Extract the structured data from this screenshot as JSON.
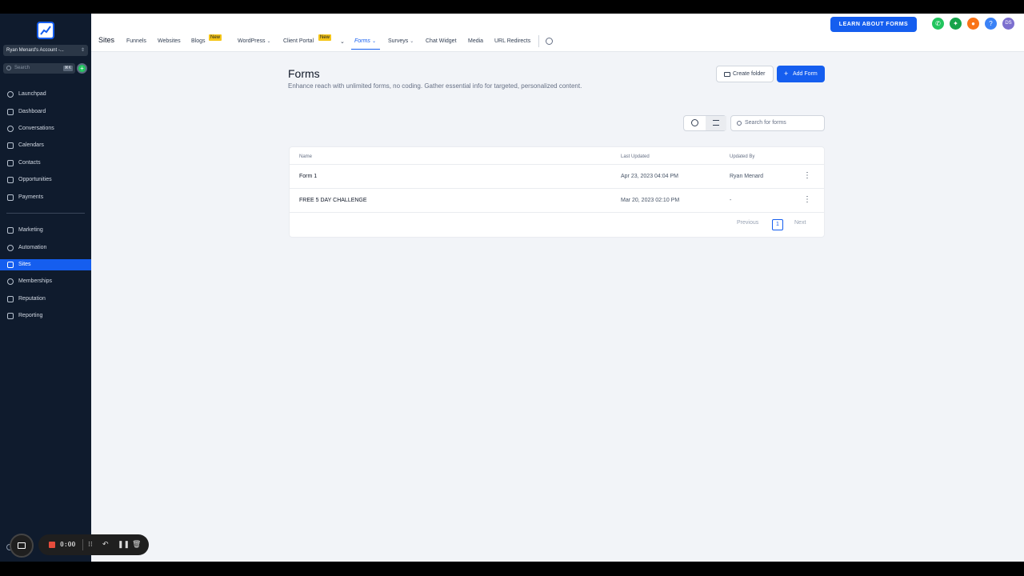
{
  "sidebar": {
    "account": "Ryan Menard's Account -...",
    "search_placeholder": "Search",
    "search_shortcut": "⌘K",
    "items": [
      {
        "label": "Launchpad",
        "icon": "rocket-icon"
      },
      {
        "label": "Dashboard",
        "icon": "dashboard-icon"
      },
      {
        "label": "Conversations",
        "icon": "chat-icon"
      },
      {
        "label": "Calendars",
        "icon": "calendar-icon"
      },
      {
        "label": "Contacts",
        "icon": "contacts-icon"
      },
      {
        "label": "Opportunities",
        "icon": "filter-icon"
      },
      {
        "label": "Payments",
        "icon": "payments-icon"
      },
      {
        "label": "Marketing",
        "icon": "send-icon"
      },
      {
        "label": "Automation",
        "icon": "automation-icon"
      },
      {
        "label": "Sites",
        "icon": "sites-icon"
      },
      {
        "label": "Memberships",
        "icon": "memberships-icon"
      },
      {
        "label": "Reputation",
        "icon": "star-icon"
      },
      {
        "label": "Reporting",
        "icon": "trend-icon"
      }
    ],
    "active_item": "Sites"
  },
  "topbar": {
    "title": "Sites",
    "tabs": [
      "Funnels",
      "Websites",
      "Blogs",
      "WordPress",
      "Client Portal",
      "Forms",
      "Surveys",
      "Chat Widget",
      "Media",
      "URL Redirects"
    ],
    "active_tab": "Forms",
    "new_badge": "New",
    "learn_button": "LEARN ABOUT FORMS",
    "avatar_initials": "DS",
    "help_glyph": "?"
  },
  "main": {
    "title": "Forms",
    "description": "Enhance reach with unlimited forms, no coding. Gather essential info for targeted, personalized content.",
    "create_folder": "Create folder",
    "add_form": "Add Form",
    "search_placeholder": "Search for forms",
    "table": {
      "headers": [
        "Name",
        "Last Updated",
        "Updated By"
      ],
      "rows": [
        {
          "name": "Form 1",
          "updated": "Apr 23, 2023 04:04 PM",
          "by": "Ryan Menard"
        },
        {
          "name": "FREE 5 DAY CHALLENGE",
          "updated": "Mar 20, 2023 02:10 PM",
          "by": "-"
        }
      ],
      "previous": "Previous",
      "page": "1",
      "next": "Next"
    }
  },
  "recorder": {
    "time": "0:00"
  },
  "colors": {
    "accent": "#155eef",
    "sidebar_bg": "#0f1b2d",
    "badge": "#f5c518"
  }
}
